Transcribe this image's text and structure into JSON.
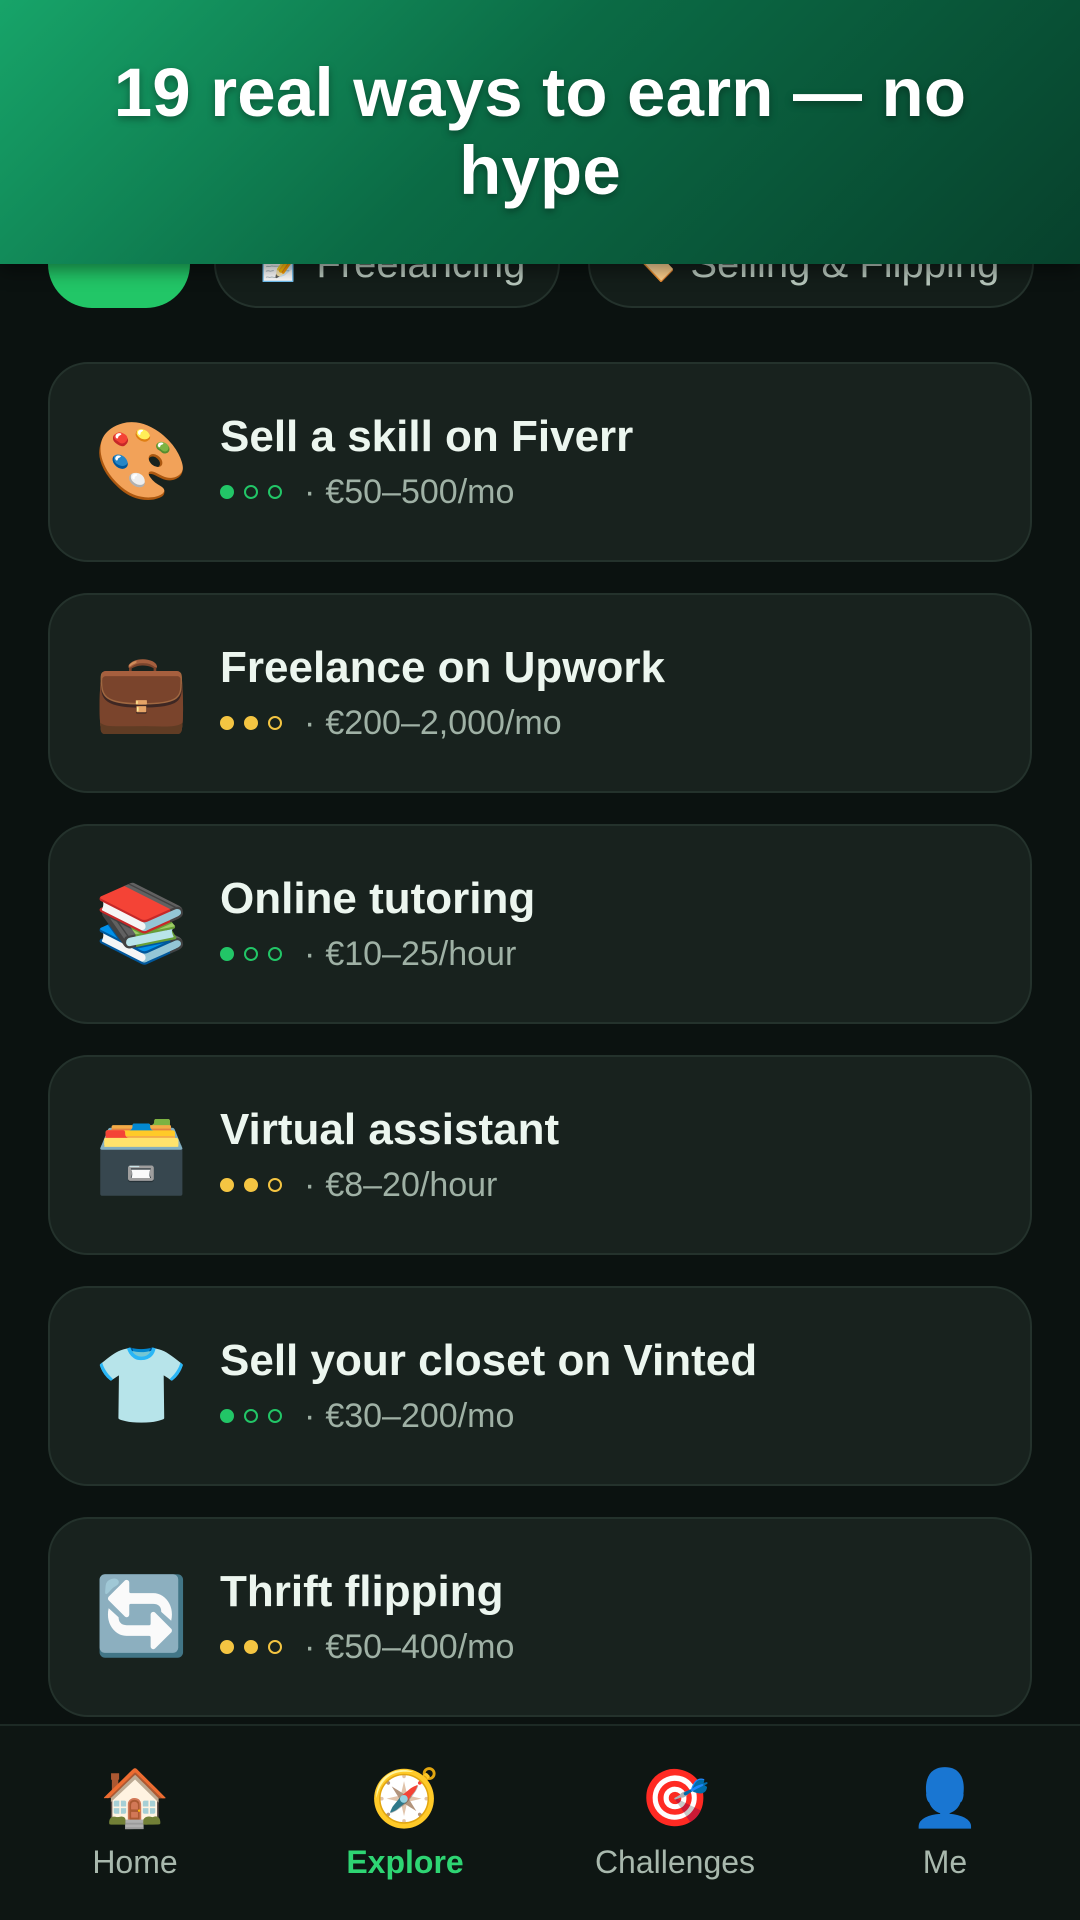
{
  "header": {
    "title": "19 real ways to earn — no hype"
  },
  "filters": [
    {
      "label": "",
      "icon": "",
      "active": true
    },
    {
      "label": "Freelancing",
      "icon": "📝",
      "active": false
    },
    {
      "label": "Selling & Flipping",
      "icon": "🏷️",
      "active": false
    }
  ],
  "cards": [
    {
      "icon": "🎨",
      "icon_name": "palette-icon",
      "title": "Sell a skill on Fiverr",
      "difficulty_level": 1,
      "difficulty_color": "green",
      "earnings": "€50–500/mo"
    },
    {
      "icon": "💼",
      "icon_name": "briefcase-icon",
      "title": "Freelance on Upwork",
      "difficulty_level": 2,
      "difficulty_color": "yellow",
      "earnings": "€200–2,000/mo"
    },
    {
      "icon": "📚",
      "icon_name": "books-icon",
      "title": "Online tutoring",
      "difficulty_level": 1,
      "difficulty_color": "green",
      "earnings": "€10–25/hour"
    },
    {
      "icon": "🗃️",
      "icon_name": "card-file-box-icon",
      "title": "Virtual assistant",
      "difficulty_level": 2,
      "difficulty_color": "yellow",
      "earnings": "€8–20/hour"
    },
    {
      "icon": "👕",
      "icon_name": "shirt-icon",
      "title": "Sell your closet on Vinted",
      "difficulty_level": 1,
      "difficulty_color": "green",
      "earnings": "€30–200/mo"
    },
    {
      "icon": "🔄",
      "icon_name": "arrows-cycle-icon",
      "title": "Thrift flipping",
      "difficulty_level": 2,
      "difficulty_color": "yellow",
      "earnings": "€50–400/mo"
    }
  ],
  "tabbar": [
    {
      "label": "Home",
      "icon": "🏠",
      "icon_name": "house-icon",
      "active": false
    },
    {
      "label": "Explore",
      "icon": "🧭",
      "icon_name": "compass-icon",
      "active": true
    },
    {
      "label": "Challenges",
      "icon": "🎯",
      "icon_name": "target-icon",
      "active": false
    },
    {
      "label": "Me",
      "icon": "👤",
      "icon_name": "person-icon",
      "active": false
    }
  ],
  "meta_separator": "·"
}
